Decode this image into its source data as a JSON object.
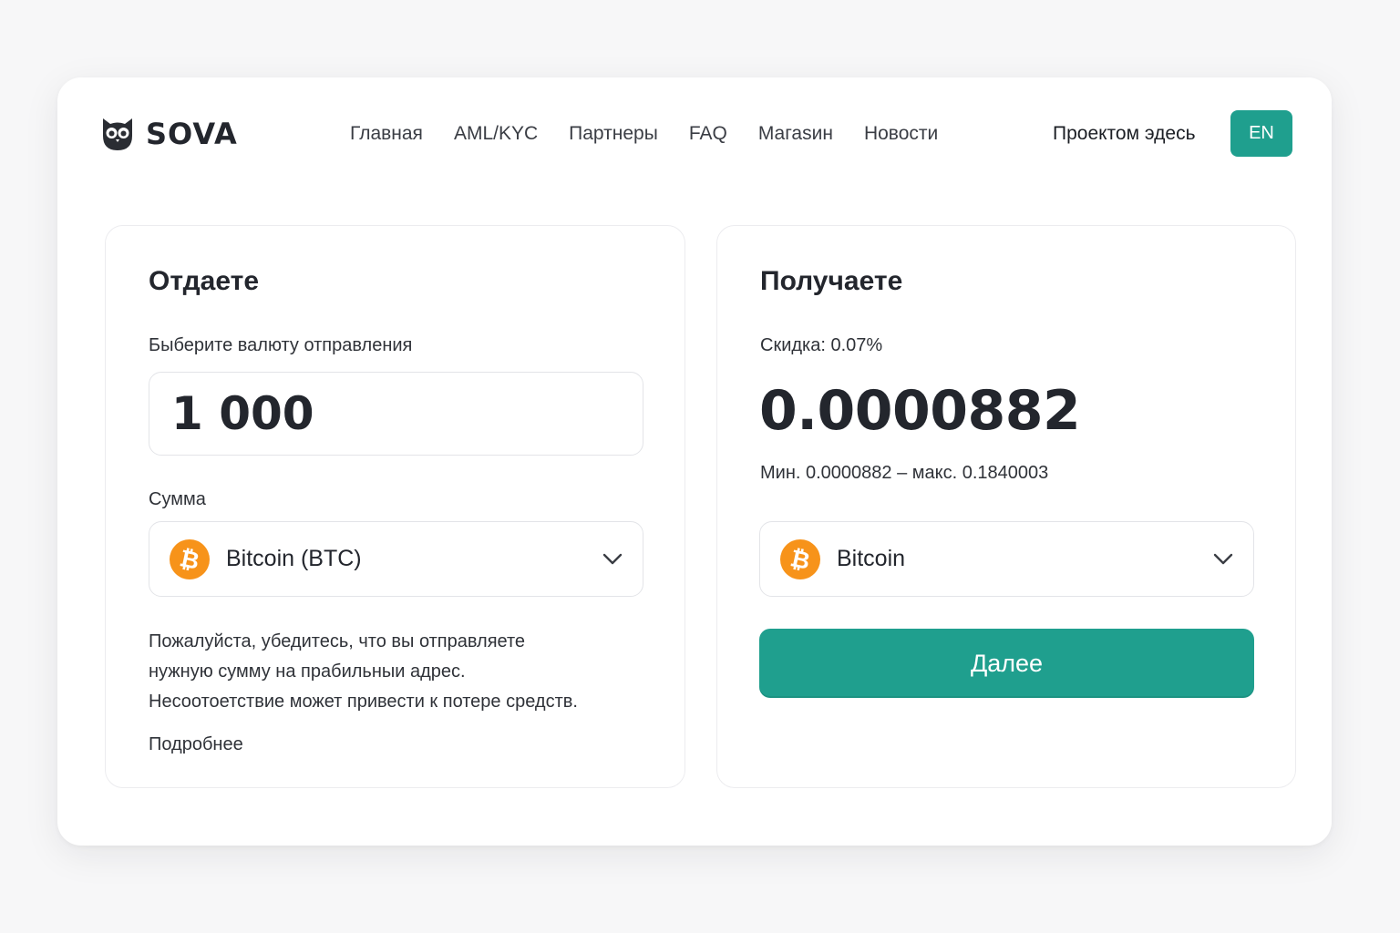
{
  "brand": {
    "name": "SOVA"
  },
  "nav": {
    "items": [
      {
        "label": "Главная"
      },
      {
        "label": "AML/KYC"
      },
      {
        "label": "Партнеры"
      },
      {
        "label": "FAQ"
      },
      {
        "label": "Магаsин"
      },
      {
        "label": "Новости"
      }
    ],
    "project_link": "Проектом эдесь",
    "language": "EN"
  },
  "give": {
    "title": "Отдаете",
    "currency_label": "Быберите валюту отправления",
    "amount_value": "1 000",
    "sum_label": "Сумма",
    "currency": {
      "name": "Bitcoin (BTC)",
      "icon": "bitcoin-icon"
    },
    "note_lines": [
      "Пожалуйста, убедитесь, что вы отправляете",
      "нужную сумму на прабильныи адрес.",
      "Несоотоетствие может привести к потере средств."
    ],
    "more_link": "Подробнее"
  },
  "receive": {
    "title": "Получаете",
    "discount": "Скидка: 0.07%",
    "amount": "0.0000882",
    "limits": "Мин. 0.0000882 – макс. 0.1840003",
    "currency": {
      "name": "Bitcoin",
      "icon": "bitcoin-icon"
    },
    "next_button": "Далее"
  },
  "colors": {
    "accent": "#1f9f8e",
    "bitcoin": "#f7931a",
    "text": "#23262d",
    "background": "#f7f7f8"
  }
}
